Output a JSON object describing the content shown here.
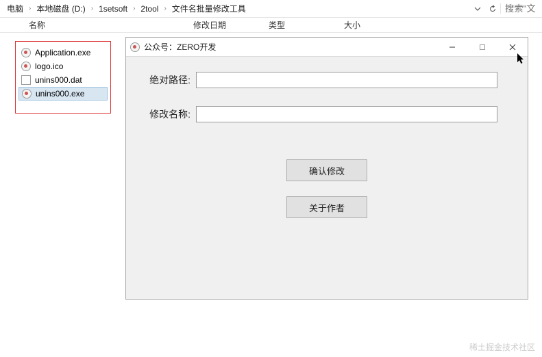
{
  "breadcrumb": {
    "items": [
      "电脑",
      "本地磁盘 (D:)",
      "1setsoft",
      "2tool",
      "文件名批量修改工具"
    ]
  },
  "toolbar": {
    "refresh_icon": "refresh",
    "dropdown_icon": "chevron-down",
    "search_placeholder": "搜索\"文"
  },
  "columns": {
    "name": "名称",
    "modified": "修改日期",
    "type": "类型",
    "size": "大小"
  },
  "files": [
    {
      "name": "Application.exe",
      "icon": "app"
    },
    {
      "name": "logo.ico",
      "icon": "app"
    },
    {
      "name": "unins000.dat",
      "icon": "doc"
    },
    {
      "name": "unins000.exe",
      "icon": "app",
      "selected": true
    }
  ],
  "dialog": {
    "title": "公众号：ZERO开发",
    "fields": {
      "path_label": "绝对路径:",
      "path_value": "",
      "name_label": "修改名称:",
      "name_value": ""
    },
    "buttons": {
      "confirm": "确认修改",
      "about": "关于作者"
    }
  },
  "watermark": "稀土掘金技术社区"
}
